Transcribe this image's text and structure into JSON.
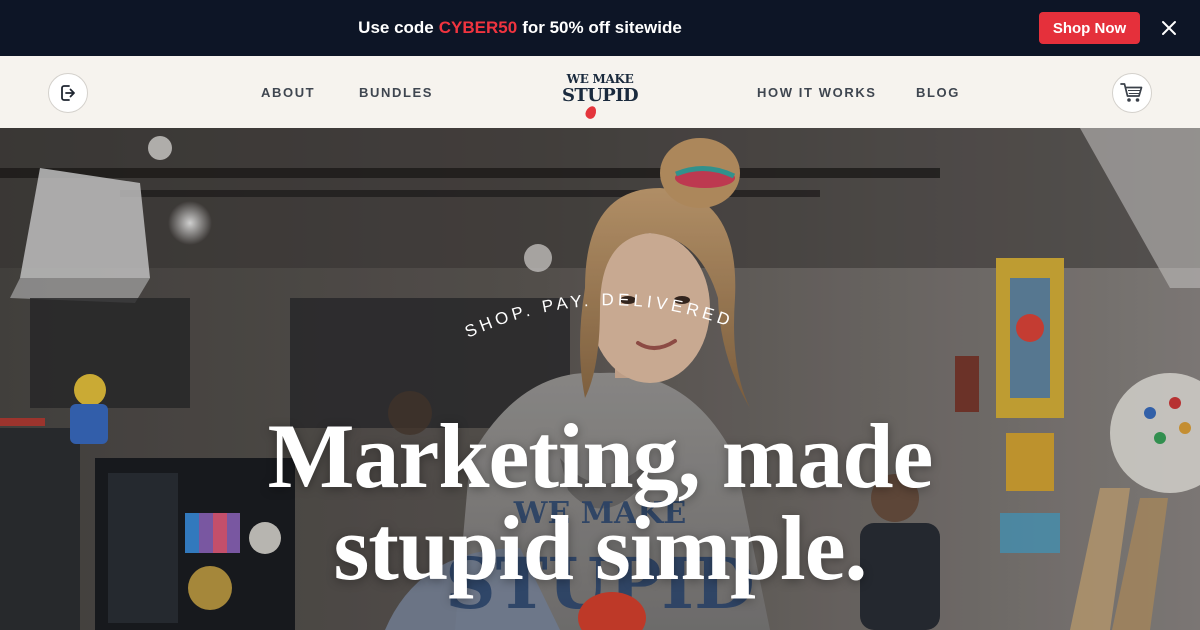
{
  "promo": {
    "text_before": "Use code",
    "code": "CYBER50",
    "text_after": "for 50% off sitewide",
    "shop_button": "Shop Now",
    "close_icon": "close-icon",
    "code_color": "#f0343f",
    "button_color": "#e5303b"
  },
  "header": {
    "login_icon": "login-icon",
    "nav": [
      "ABOUT",
      "BUNDLES",
      "HOW IT WORKS",
      "BLOG"
    ],
    "logo": {
      "line1": "WE MAKE",
      "line2": "STUPID"
    },
    "cart_icon": "cart-icon"
  },
  "hero": {
    "tagline": "SHOP. PAY. DELIVERED.",
    "headline_line1": "Marketing, made",
    "headline_line2": "stupid simple."
  }
}
